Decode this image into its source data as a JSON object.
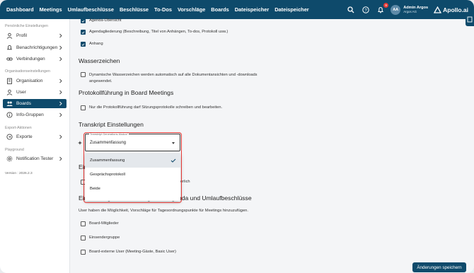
{
  "nav": {
    "items": [
      "Dashboard",
      "Meetings",
      "Umlaufbeschlüsse",
      "Beschlüsse",
      "To-Dos",
      "Vorschläge",
      "Boards",
      "Dateispeicher",
      "Dateispeicher"
    ]
  },
  "topbar": {
    "notification_count": "9",
    "user_initials": "AA",
    "user_name": "Admin Argos",
    "user_org": "Argos AG",
    "logo_text": "Apollo.ai"
  },
  "sidebar": {
    "personal_title": "Persönliche Einstellungen",
    "profil": "Profil",
    "benachrichtigungen": "Benachrichtigungen",
    "verbindungen": "Verbindungen",
    "org_title": "Organisationseinstellungen",
    "organisation": "Organisation",
    "user": "User",
    "boards": "Boards",
    "info_gruppen": "Info-Gruppen",
    "export_title": "Export-Aktionen",
    "exporte": "Exporte",
    "playground_title": "Playground",
    "notification_tester": "Notification Tester",
    "version": "Version : 2026.2.3"
  },
  "content": {
    "cb_agenda_overview": "Agenda-Übersicht",
    "cb_agenda_structure": "Agendagliederung (Beschreibung, Titel von Anhängen, To-dos, Protokoll usw.)",
    "cb_attachment": "Anhang",
    "watermark_heading": "Wasserzeichen",
    "watermark_cb": "Dynamische Wasserzeichen werden automatisch auf alle Dokumentansichten und -downloads angewendet.",
    "protocol_heading": "Protokollführung in Board Meetings",
    "protocol_cb": "Nur die Protokollführung darf Sitzungsprotokolle schreiben und bearbeiten.",
    "transcript_heading": "Transkript Einstellungen",
    "select_label": "Transkript Generations-Modus*",
    "select_value": "Zusammenfassung",
    "menu_options": [
      "Zusammenfassung",
      "Gesprächsprotokoll",
      "Beide"
    ],
    "hidden_heading_fragment": "Eins",
    "hidden_text_fragment": "erlich",
    "proposals_heading": "Einreichung von Vorschlägen für Agenda und Umlaufbeschlüsse",
    "proposals_desc": "User haben die Möglichkeit, Vorschläge für Tagesordnungspunkte für Meetings hinzuzufügen.",
    "cb_board_members": "Board-Mitglieder",
    "cb_submitter_group": "Einsendergruppe",
    "cb_external_users": "Board-externe User (Meeting-Gäste, Basic User)",
    "save_button": "Änderungen speichern"
  },
  "colors": {
    "primary": "#0e4a6b",
    "highlight": "#e53935"
  }
}
